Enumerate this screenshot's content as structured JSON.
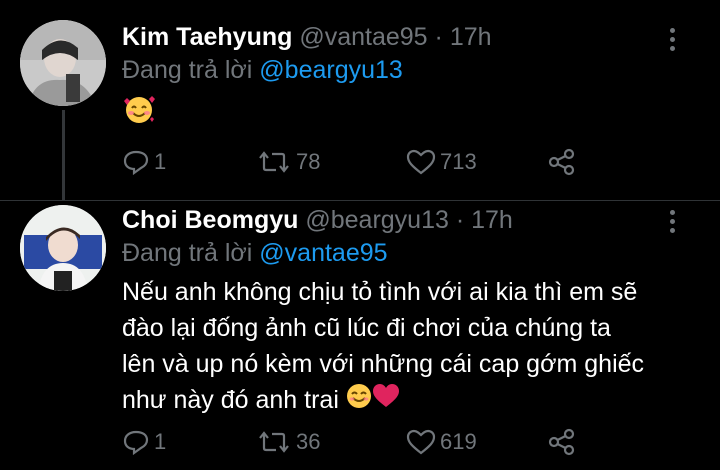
{
  "tweets": [
    {
      "name": "Kim Taehyung",
      "handle": "@vantae95",
      "separator": "·",
      "time": "17h",
      "reply_prefix": "Đang trả lời",
      "reply_to": "@beargyu13",
      "body_emoji": "smiling-face-with-hearts",
      "stats": {
        "replies": "1",
        "retweets": "78",
        "likes": "713"
      }
    },
    {
      "name": "Choi Beomgyu",
      "handle": "@beargyu13",
      "separator": "·",
      "time": "17h",
      "reply_prefix": "Đang trả lời",
      "reply_to": "@vantae95",
      "text_lines": [
        "Nếu anh không chịu tỏ tình với ai kia thì em sẽ",
        "đào lại đống ảnh cũ lúc đi chơi của chúng ta",
        "lên và up nó kèm với những cái cap gớm ghiếc",
        "như này đó anh trai"
      ],
      "trailing_emojis": [
        "smiling-face-with-smiling-eyes",
        "red-heart"
      ],
      "stats": {
        "replies": "1",
        "retweets": "36",
        "likes": "619"
      }
    }
  ],
  "colors": {
    "background": "#000000",
    "name": "#ffffff",
    "muted": "#71767b",
    "link": "#1d9bf0"
  }
}
